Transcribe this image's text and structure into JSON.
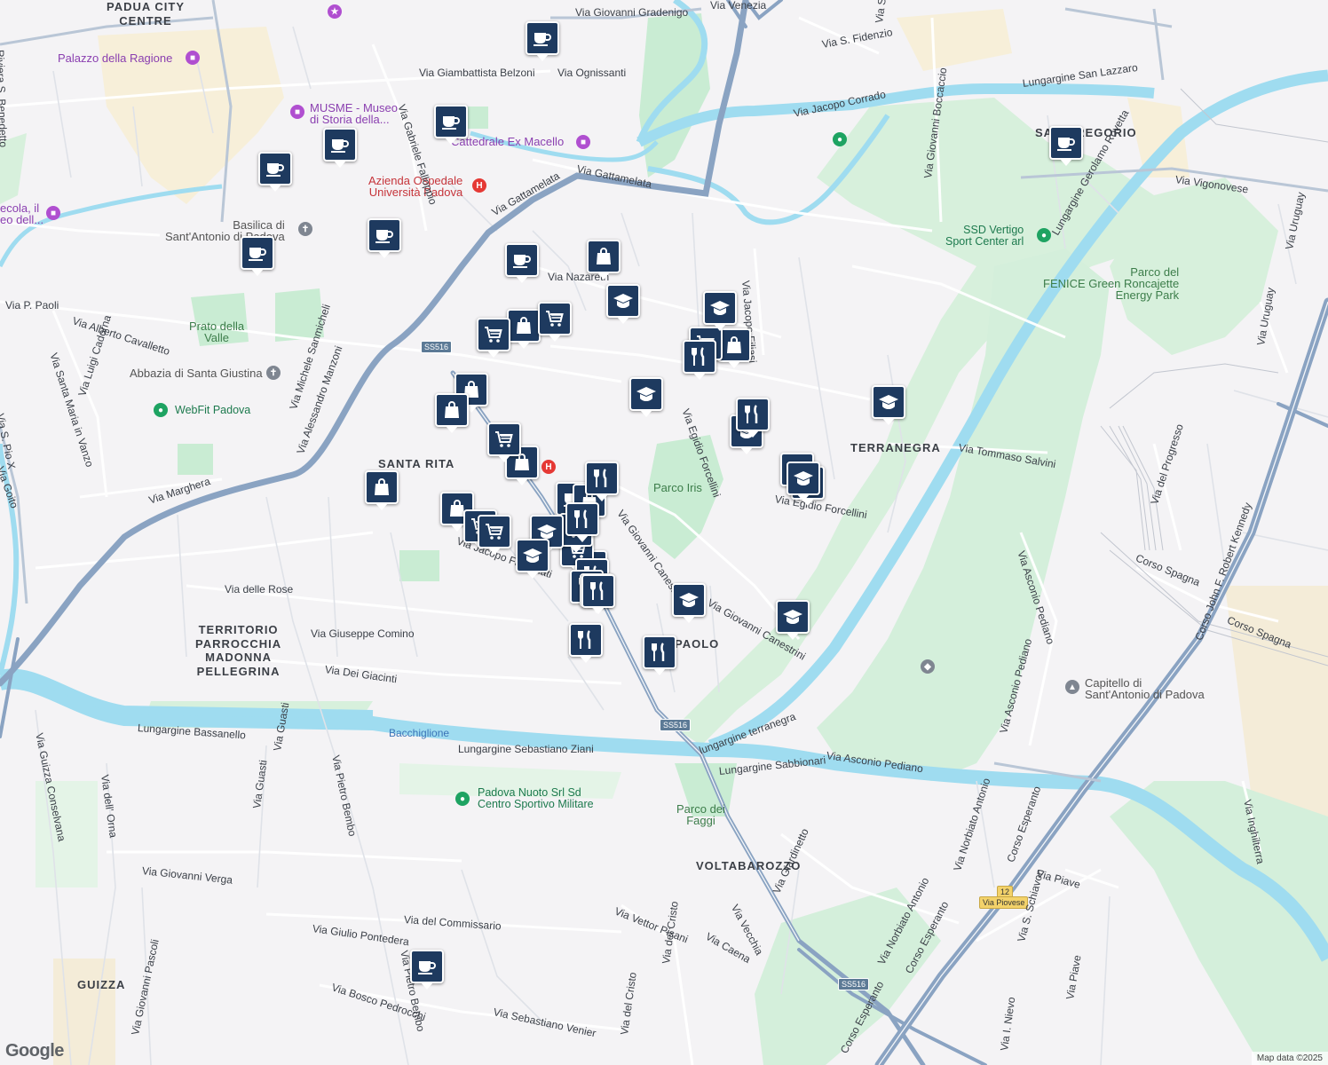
{
  "map": {
    "attribution": "Map data ©2025",
    "logo": "Google",
    "labels": {
      "padua_centre": "PADUA CITY\nCENTRE",
      "santa_rita": "SANTA RITA",
      "terranegra": "TERRANEGRA",
      "territorio": "TERRITORIO\nPARROCCHIA\nMADONNA\nPELLEGRINA",
      "san_paolo": "PAOLO",
      "voltabarozzo": "VOLTABAROZZO",
      "guizza": "GUIZZA",
      "san_gregorio": "SAN GREGORIO",
      "palazzo": "Palazzo della Ragione",
      "musme": "MUSME - Museo\ndi Storia della...",
      "cattedrale": "Cattedrale Ex Macello",
      "azienda": "Azienda Ospedale\nUniversità Padova",
      "basilica": "Basilica di\nSant'Antonio di Padova",
      "prato": "Prato della\nValle",
      "abbazia": "Abbazia di Santa Giustina",
      "webfit": "WebFit Padova",
      "parco_iris": "Parco Iris",
      "ssd": "SSD Vertigo\nSport Center arl",
      "fenice": "Parco del\nFENICE Green Roncajette\nEnergy Park",
      "capitello": "Capitello di\nSant'Antonio di Padova",
      "padova_nuoto": "Padova Nuoto Srl Sd\nCentro Sportivo Militare",
      "parco_faggi": "Parco dei\nFaggi",
      "bacchiglione": "Bacchiglione",
      "ecola": "ecola, il\neo dell...",
      "ss516_a": "SS516",
      "ss516_b": "SS516",
      "ss516_c": "SS516",
      "route12": "12",
      "via_piovese_shield": "Via Piovese"
    },
    "streets": [
      "Via Giovanni Gradenigo",
      "Via Giambattista Belzoni",
      "Via Ognissanti",
      "Via S. Fidenzio",
      "Lungargine San Lazzaro",
      "Via Jacopo Corrado",
      "Via Gattamelata",
      "Via Gattamelata",
      "Via Vigonovese",
      "Via Nazareth",
      "Via Jacopo Filiasi",
      "Via Egidio Forcellini",
      "Via Egidio Forcellini",
      "Via Tommaso Salvini",
      "Via Giovanni Canestrini",
      "Via Giovanni Canestrini",
      "Via Alberto Cavalletto",
      "Via P. Paoli",
      "Via Luigi Cadorna",
      "Via Santa Maria in Vanzo",
      "Via Michele Sanmicheli",
      "Via Alessandro Manzoni",
      "Via Marghera",
      "Via Jacopo Facciolati",
      "Via delle Rose",
      "Via Giuseppe Comino",
      "Via Dei Giacinti",
      "Lungargine Bassanello",
      "Lungargine Sebastiano Ziani",
      "Lungargine Sabbionari",
      "Via Asconio Pediano",
      "Via Asconio Pediano",
      "Via Asconio Pediano",
      "lungargine terranegra",
      "Corso Spagna",
      "Corso Spagna",
      "Corso John F. Robert Kennedy",
      "Via del Progresso",
      "Via Uruguay",
      "Via Uruguay",
      "Via Guizza Conselvana",
      "Via dell' Orna",
      "Via Guasti",
      "Via Guasti",
      "Via Pietro Bembo",
      "Via Pietro Bembo",
      "Via Giovanni Verga",
      "Via del Commissario",
      "Via Giulio Pontedera",
      "Via Bosco Pedrocchi",
      "Via Sebastiano Venier",
      "Via Giovanni Pascoli",
      "Via Vettor Pisani",
      "Via del Cristo",
      "Via del Cristo",
      "Via Caena",
      "Via Vecchia",
      "Via Giardinetto",
      "Via Norbiato Antonio",
      "Via Norbiato Antonio",
      "Corso Esperanto",
      "Corso Esperanto",
      "Corso Esperanto",
      "Via Piave",
      "Via Piave",
      "Via S. Schiavon",
      "Via I. Nievo",
      "Via Inghilterra",
      "Via Giovanni Boccaccio",
      "Lungargine Gerolamo Rovetta",
      "Via Gabriele Falloppio",
      "Riviera S. Benedetto",
      "Via S. Pio X",
      "Via Goito",
      "Via Sartori Dona",
      "Via Venezia"
    ],
    "markers": [
      {
        "type": "cafe",
        "label": "cafe-icon"
      },
      {
        "type": "cafe",
        "label": "cafe-icon"
      },
      {
        "type": "cafe",
        "label": "cafe-icon"
      },
      {
        "type": "cafe",
        "label": "cafe-icon"
      },
      {
        "type": "cafe",
        "label": "cafe-icon"
      },
      {
        "type": "cafe",
        "label": "cafe-icon"
      },
      {
        "type": "cafe",
        "label": "cafe-icon"
      },
      {
        "type": "cafe",
        "label": "cafe-icon"
      },
      {
        "type": "cafe",
        "label": "cafe-icon"
      },
      {
        "type": "cafe",
        "label": "cafe-icon"
      },
      {
        "type": "cafe",
        "label": "cafe-icon"
      },
      {
        "type": "shop",
        "label": "shopping-bag-icon"
      },
      {
        "type": "shop",
        "label": "shopping-bag-icon"
      },
      {
        "type": "shop",
        "label": "shopping-bag-icon"
      },
      {
        "type": "shop",
        "label": "shopping-bag-icon"
      },
      {
        "type": "shop",
        "label": "shopping-bag-icon"
      },
      {
        "type": "shop",
        "label": "shopping-bag-icon"
      },
      {
        "type": "shop",
        "label": "shopping-bag-icon"
      },
      {
        "type": "shop",
        "label": "shopping-bag-icon"
      },
      {
        "type": "shop",
        "label": "shopping-bag-icon"
      },
      {
        "type": "shop",
        "label": "shopping-bag-icon"
      },
      {
        "type": "cart",
        "label": "shopping-cart-icon"
      },
      {
        "type": "cart",
        "label": "shopping-cart-icon"
      },
      {
        "type": "cart",
        "label": "shopping-cart-icon"
      },
      {
        "type": "cart",
        "label": "shopping-cart-icon"
      },
      {
        "type": "cart",
        "label": "shopping-cart-icon"
      },
      {
        "type": "cart",
        "label": "shopping-cart-icon"
      },
      {
        "type": "cart",
        "label": "shopping-cart-icon"
      },
      {
        "type": "cart",
        "label": "shopping-cart-icon"
      },
      {
        "type": "school",
        "label": "school-icon"
      },
      {
        "type": "school",
        "label": "school-icon"
      },
      {
        "type": "school",
        "label": "school-icon"
      },
      {
        "type": "school",
        "label": "school-icon"
      },
      {
        "type": "school",
        "label": "school-icon"
      },
      {
        "type": "school",
        "label": "school-icon"
      },
      {
        "type": "school",
        "label": "school-icon"
      },
      {
        "type": "school",
        "label": "school-icon"
      },
      {
        "type": "school",
        "label": "school-icon"
      },
      {
        "type": "school",
        "label": "school-icon"
      },
      {
        "type": "school",
        "label": "school-icon"
      },
      {
        "type": "restaurant",
        "label": "restaurant-icon"
      },
      {
        "type": "restaurant",
        "label": "restaurant-icon"
      },
      {
        "type": "restaurant",
        "label": "restaurant-icon"
      },
      {
        "type": "restaurant",
        "label": "restaurant-icon"
      },
      {
        "type": "restaurant",
        "label": "restaurant-icon"
      },
      {
        "type": "restaurant",
        "label": "restaurant-icon"
      },
      {
        "type": "restaurant",
        "label": "restaurant-icon"
      },
      {
        "type": "restaurant",
        "label": "restaurant-icon"
      },
      {
        "type": "restaurant",
        "label": "restaurant-icon"
      },
      {
        "type": "restaurant",
        "label": "restaurant-icon"
      }
    ],
    "colors": {
      "background": "#f4f3f5",
      "water": "#9fdcf0",
      "park": "#c9ecd3",
      "highway": "#8aa3c2",
      "marker": "#1e3a5f",
      "poi_purple": "#b04fd0",
      "poi_red": "#e53935",
      "poi_green": "#1ea362"
    }
  }
}
